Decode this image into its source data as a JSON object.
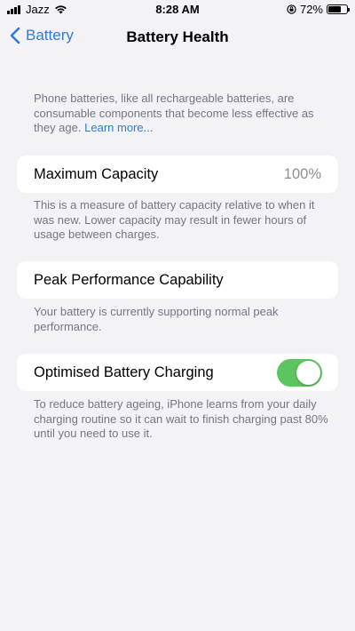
{
  "status_bar": {
    "carrier": "Jazz",
    "time": "8:28 AM",
    "battery_percent": "72%",
    "battery_level": 0.72,
    "icons": [
      "signal-icon",
      "wifi-icon",
      "orientation-lock-icon",
      "battery-icon"
    ]
  },
  "nav": {
    "back_label": "Battery",
    "title": "Battery Health"
  },
  "intro": {
    "text": "Phone batteries, like all rechargeable batteries, are consumable components that become less effective as they age.",
    "link": "Learn more..."
  },
  "maximum_capacity": {
    "label": "Maximum Capacity",
    "value": "100%",
    "footnote": "This is a measure of battery capacity relative to when it was new. Lower capacity may result in fewer hours of usage between charges."
  },
  "peak_performance": {
    "label": "Peak Performance Capability",
    "footnote": "Your battery is currently supporting normal peak performance."
  },
  "optimised_charging": {
    "label": "Optimised Battery Charging",
    "enabled": true,
    "footnote": "To reduce battery ageing, iPhone learns from your daily charging routine so it can wait to finish charging past 80% until you need to use it."
  },
  "colors": {
    "accent": "#2f7bd9",
    "toggle_on": "#5cc55f",
    "background": "#f2f2f7",
    "secondary_text": "#767680"
  }
}
